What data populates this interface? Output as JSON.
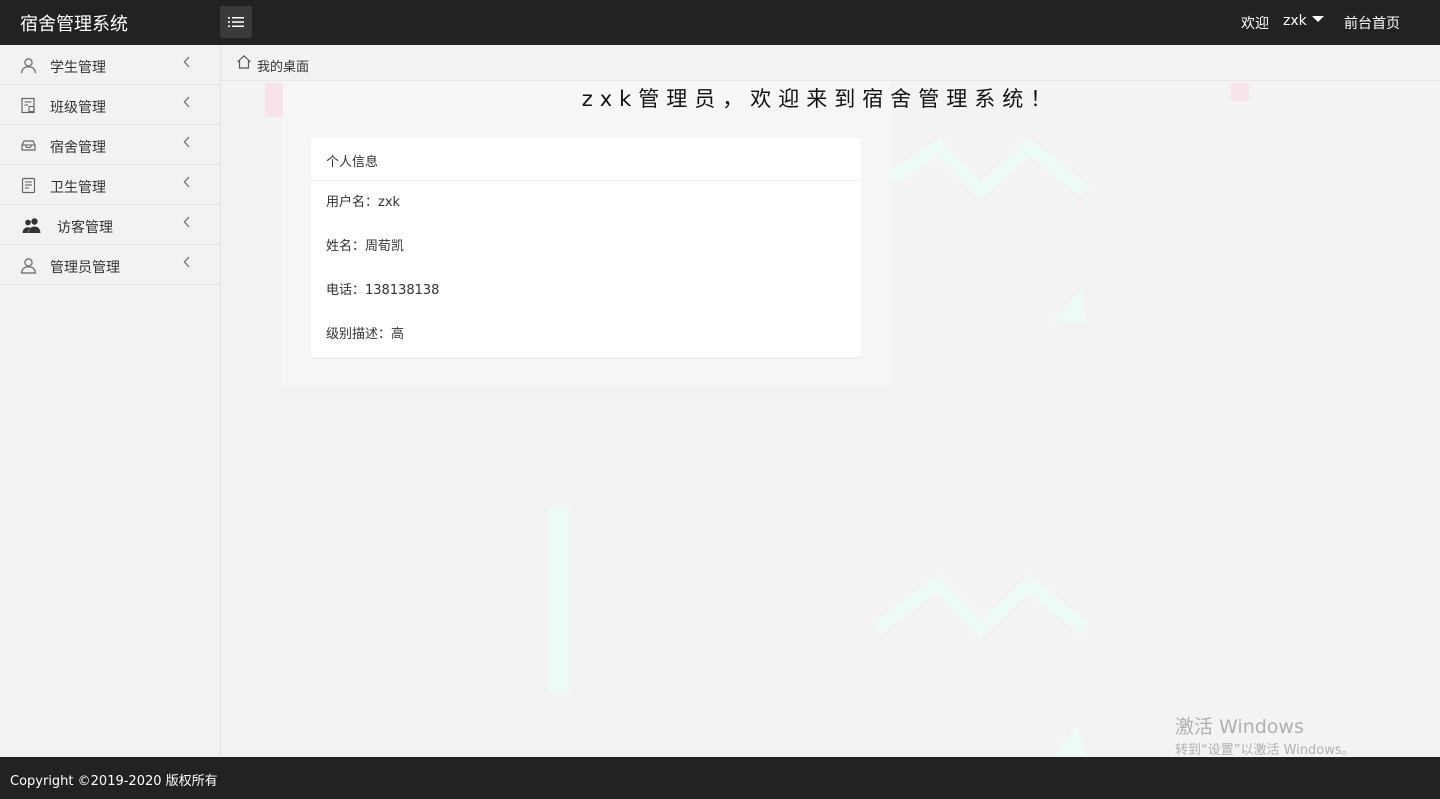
{
  "header": {
    "logo": "宿舍管理系统",
    "welcome": "欢迎",
    "username": "zxk",
    "front_home": "前台首页"
  },
  "sidebar": {
    "items": [
      {
        "label": "学生管理",
        "icon": "user-icon"
      },
      {
        "label": "班级管理",
        "icon": "class-icon"
      },
      {
        "label": "宿舍管理",
        "icon": "dorm-icon"
      },
      {
        "label": "卫生管理",
        "icon": "hygiene-icon"
      },
      {
        "label": "访客管理",
        "icon": "visitors-icon"
      },
      {
        "label": "管理员管理",
        "icon": "admin-icon"
      }
    ]
  },
  "breadcrumb": {
    "label": "我的桌面"
  },
  "main": {
    "title": "zxk管理员，欢迎来到宿舍管理系统！"
  },
  "card": {
    "header": "个人信息",
    "rows": [
      "用户名：zxk",
      "姓名：周荀凯",
      "电话：138138138",
      "级别描述：高"
    ]
  },
  "watermark": {
    "line1": "激活 Windows",
    "line2": "转到“设置”以激活 Windows。"
  },
  "footer": {
    "copyright": "Copyright ©2019-2020 版权所有"
  },
  "colors": {
    "header_bg": "#222222",
    "sidebar_bg": "#f2f2f2",
    "deco_mint": "#eefaf6",
    "deco_pink": "#f8e4e8"
  }
}
